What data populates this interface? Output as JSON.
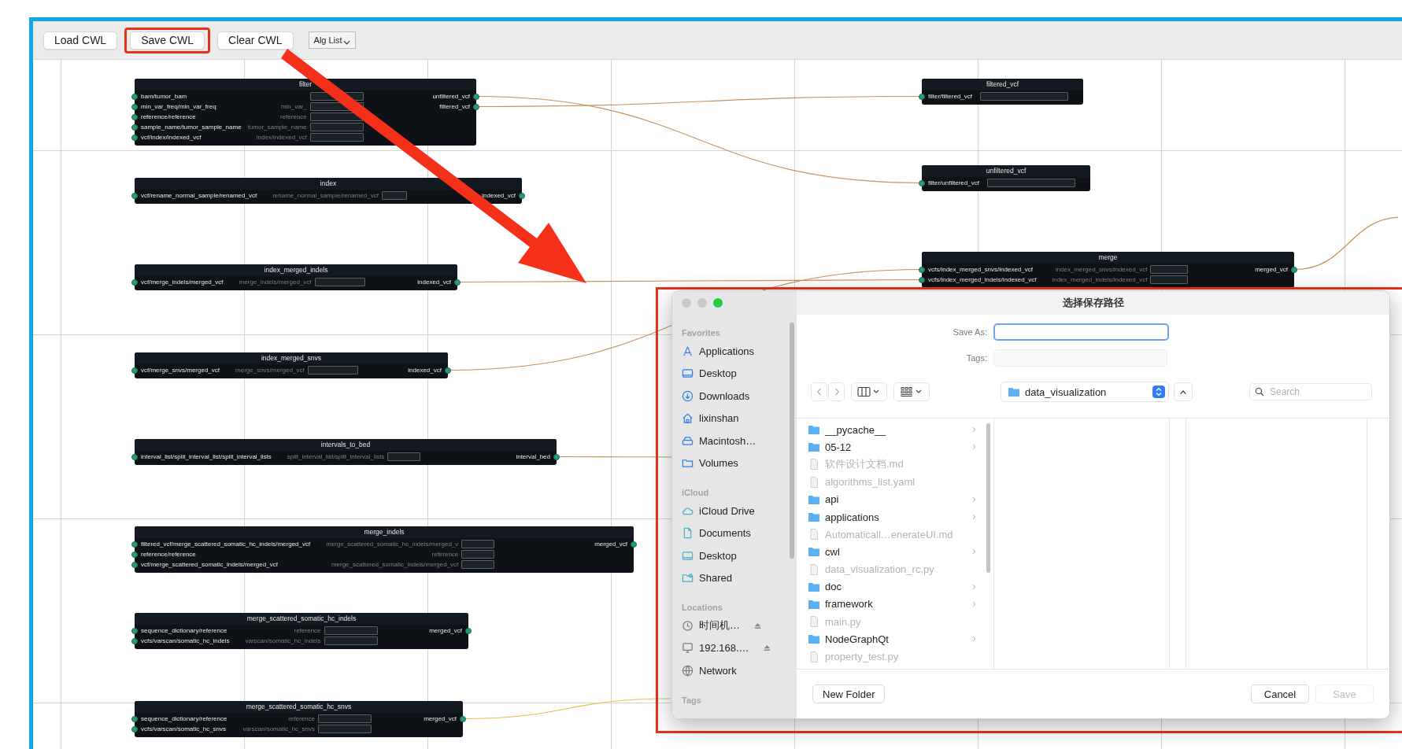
{
  "toolbar": {
    "buttons": [
      {
        "label": "Load CWL",
        "highlighted": false
      },
      {
        "label": "Save CWL",
        "highlighted": true
      },
      {
        "label": "Clear CWL",
        "highlighted": false
      }
    ],
    "dropdown": {
      "label": "Alg List"
    }
  },
  "nodes": [
    {
      "title": "filter",
      "inputs": [
        "bam/tumor_bam",
        "min_var_freq/min_var_freq",
        "reference/reference",
        "sample_name/tumor_sample_name",
        "vcf/index/indexed_vcf"
      ],
      "widgets": [
        {
          "kind": "field"
        },
        {
          "kind": "field",
          "label": "min_var_"
        },
        {
          "kind": "field",
          "label": "reference"
        },
        {
          "kind": "field",
          "label": "tumor_sample_name"
        },
        {
          "kind": "field",
          "label": "index/indexed_vcf"
        }
      ],
      "outputs": [
        "unfiltered_vcf",
        "filtered_vcf"
      ]
    },
    {
      "title": "index",
      "inputs": [
        "vcf/rename_normal_sample/renamed_vcf"
      ],
      "widgets": [
        {
          "kind": "field",
          "label": "rename_normal_sample/renamed_vcf"
        }
      ],
      "outputs": [
        "indexed_vcf"
      ]
    },
    {
      "title": "index_merged_indels",
      "inputs": [
        "vcf/merge_indels/merged_vcf"
      ],
      "widgets": [
        {
          "kind": "field",
          "label": "merge_indels/merged_vcf"
        }
      ],
      "outputs": [
        "indexed_vcf"
      ]
    },
    {
      "title": "index_merged_snvs",
      "inputs": [
        "vcf/merge_snvs/merged_vcf"
      ],
      "widgets": [
        {
          "kind": "field",
          "label": "merge_snvs/merged_vcf"
        }
      ],
      "outputs": [
        "indexed_vcf"
      ]
    },
    {
      "title": "intervals_to_bed",
      "inputs": [
        "interval_list/split_interval_list/split_interval_lists"
      ],
      "widgets": [
        {
          "kind": "field",
          "label": "split_interval_list/split_interval_lists"
        }
      ],
      "outputs": [
        "interval_bed"
      ]
    },
    {
      "title": "merge_indels",
      "inputs": [
        "filtered_vcf/merge_scattered_somatic_hc_indels/merged_vcf",
        "reference/reference",
        "vcf/merge_scattered_somatic_indels/merged_vcf"
      ],
      "widgets": [
        {
          "kind": "field",
          "label": "merge_scattered_somatic_hc_indels/merged_v"
        },
        {
          "kind": "field",
          "label": "reference"
        },
        {
          "kind": "field",
          "label": "merge_scattered_somatic_indels/merged_vcf"
        }
      ],
      "outputs": [
        "merged_vcf"
      ]
    },
    {
      "title": "merge_scattered_somatic_hc_indels",
      "inputs": [
        "sequence_dictionary/reference",
        "vcfs/varscan/somatic_hc_indels"
      ],
      "widgets": [
        {
          "kind": "field",
          "label": "reference"
        },
        {
          "kind": "field",
          "label": "varscan/somatic_hc_indels"
        }
      ],
      "outputs": [
        "merged_vcf"
      ]
    },
    {
      "title": "merge_scattered_somatic_hc_snvs",
      "inputs": [
        "sequence_dictionary/reference",
        "vcfs/varscan/somatic_hc_snvs"
      ],
      "widgets": [
        {
          "kind": "field",
          "label": "reference"
        },
        {
          "kind": "field",
          "label": "varscan/somatic_hc_snvs"
        }
      ],
      "outputs": [
        "merged_vcf"
      ]
    },
    {
      "title": "filtered_vcf",
      "inputs": [
        "filter/filtered_vcf"
      ],
      "widgets": [
        {
          "kind": "field"
        }
      ]
    },
    {
      "title": "unfiltered_vcf",
      "inputs": [
        "filter/unfiltered_vcf"
      ],
      "widgets": [
        {
          "kind": "field"
        }
      ]
    },
    {
      "title": "merge",
      "inputs": [
        "vcfs/index_merged_snvs/indexed_vcf",
        "vcfs/index_merged_indels/indexed_vcf"
      ],
      "widgets": [
        {
          "kind": "field",
          "label": "index_merged_snvs/indexed_vcf"
        },
        {
          "kind": "field",
          "label": "index_merged_indels/indexed_vcf"
        }
      ],
      "outputs": [
        "merged_vcf"
      ]
    }
  ],
  "dialog": {
    "title": "选择保存路径",
    "sidebar": [
      {
        "heading": "Favorites",
        "items": [
          {
            "label": "Applications"
          },
          {
            "label": "Desktop"
          },
          {
            "label": "Downloads"
          },
          {
            "label": "lixinshan"
          },
          {
            "label": "Macintosh…"
          },
          {
            "label": "Volumes"
          }
        ]
      },
      {
        "heading": "iCloud",
        "items": [
          {
            "label": "iCloud Drive"
          },
          {
            "label": "Documents"
          },
          {
            "label": "Desktop"
          },
          {
            "label": "Shared"
          }
        ]
      },
      {
        "heading": "Locations",
        "items": [
          {
            "label": "时间机…",
            "ejectable": true
          },
          {
            "label": "192.168.…",
            "ejectable": true
          },
          {
            "label": "Network",
            "ejectable": false
          }
        ]
      },
      {
        "heading": "Tags"
      }
    ],
    "save_as": {
      "label": "Save As:",
      "focused": true
    },
    "tags": {
      "label": "Tags:"
    },
    "location": {
      "label": "data_visualization"
    },
    "search": {
      "placeholder": "Search"
    },
    "files": [
      {
        "name": "__pycache__",
        "kind": "folder",
        "disabled": false
      },
      {
        "name": "05-12",
        "kind": "folder",
        "disabled": false
      },
      {
        "name": "软件设计文档.md",
        "kind": "file",
        "disabled": true
      },
      {
        "name": "algorithms_list.yaml",
        "kind": "file",
        "disabled": true
      },
      {
        "name": "api",
        "kind": "folder",
        "disabled": false
      },
      {
        "name": "applications",
        "kind": "folder",
        "disabled": false
      },
      {
        "name": "Automaticall…enerateUI.md",
        "kind": "file",
        "disabled": true
      },
      {
        "name": "cwl",
        "kind": "folder",
        "disabled": false
      },
      {
        "name": "data_visualization_rc.py",
        "kind": "file",
        "disabled": true
      },
      {
        "name": "doc",
        "kind": "folder",
        "disabled": false
      },
      {
        "name": "framework",
        "kind": "folder",
        "disabled": false
      },
      {
        "name": "main.py",
        "kind": "file",
        "disabled": true
      },
      {
        "name": "NodeGraphQt",
        "kind": "folder",
        "disabled": false
      },
      {
        "name": "property_test.py",
        "kind": "file",
        "disabled": true
      }
    ],
    "buttons": [
      {
        "label": "New Folder",
        "disabled": false
      },
      {
        "label": "Cancel",
        "disabled": false
      },
      {
        "label": "Save",
        "disabled": true
      }
    ]
  }
}
